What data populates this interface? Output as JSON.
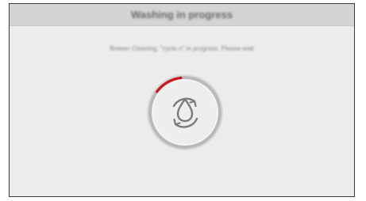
{
  "header": {
    "title": "Washing in progress"
  },
  "message": {
    "text": "Brewer Cleaning, \"cycle n\" in progress. Please wait"
  },
  "progress": {
    "fraction": 0.14,
    "accent_color": "#d4121d",
    "ring_color": "#bdbdbd",
    "icon": "water-drop-cycle-icon"
  }
}
